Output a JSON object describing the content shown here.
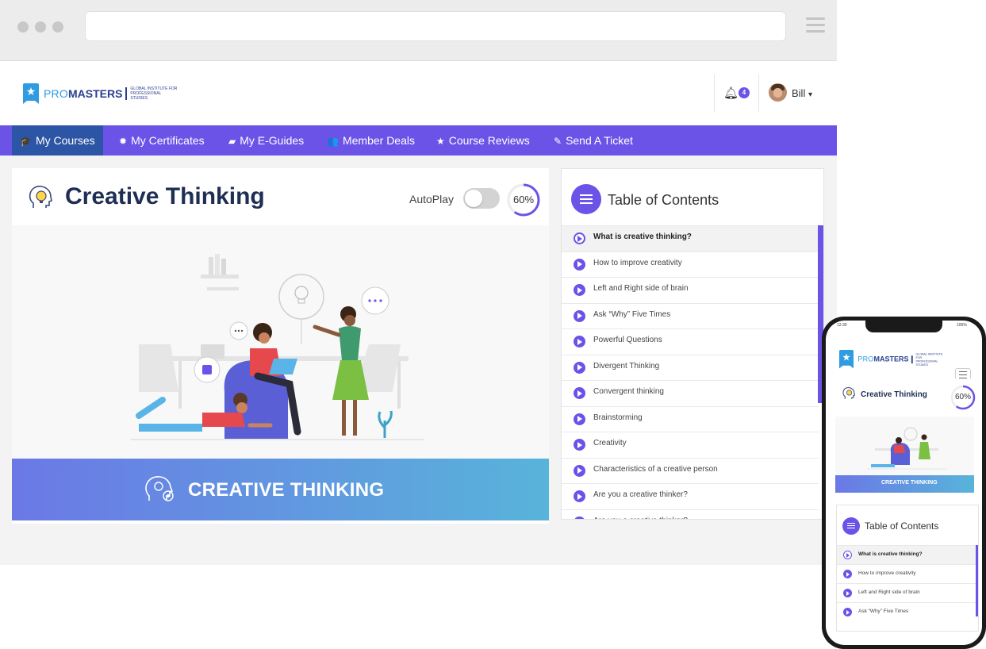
{
  "logo": {
    "pro": "PRO",
    "masters": "MASTERS",
    "tagline_1": "GLOBAL INSTITUTE FOR",
    "tagline_2": "PROFESSIONAL STUDIES"
  },
  "header": {
    "notification_count": "4",
    "user_name": "Bill",
    "user_caret": "▾"
  },
  "nav": [
    {
      "label": "My Courses",
      "icon": "graduation-cap-icon",
      "glyph": "🎓",
      "active": true
    },
    {
      "label": "My Certificates",
      "icon": "certificate-icon",
      "glyph": "✹",
      "active": false
    },
    {
      "label": "My E-Guides",
      "icon": "book-icon",
      "glyph": "▰",
      "active": false
    },
    {
      "label": "Member Deals",
      "icon": "users-icon",
      "glyph": "👥",
      "active": false
    },
    {
      "label": "Course Reviews",
      "icon": "star-icon",
      "glyph": "★",
      "active": false
    },
    {
      "label": "Send A Ticket",
      "icon": "edit-icon",
      "glyph": "✎",
      "active": false
    }
  ],
  "course": {
    "title": "Creative Thinking",
    "autoplay_label": "AutoPlay",
    "autoplay_on": false,
    "progress": 0.6,
    "progress_label": "60%",
    "banner_text": "CREATIVE THINKING"
  },
  "toc": {
    "title": "Table of Contents",
    "items": [
      "What is creative thinking?",
      "How to improve creativity",
      "Left and Right side of brain",
      "Ask “Why” Five Times",
      "Powerful Questions",
      "Divergent Thinking",
      "Convergent thinking",
      "Brainstorming",
      "Creativity",
      "Characteristics of a creative person",
      "Are you a creative thinker?",
      "Are you a creative thinker?"
    ]
  },
  "phone": {
    "time": "12:30",
    "battery": "100%",
    "course_title": "Creative Thinking",
    "progress_label": "60%",
    "banner_text": "CREATIVE THINKING",
    "toc_title": "Table of Contents",
    "toc_items": [
      "What is creative thinking?",
      "How to improve creativity",
      "Left and Right side of brain",
      "Ask “Why” Five Times"
    ]
  },
  "colors": {
    "accent": "#6b53e8",
    "nav_active": "#2d55a5",
    "title": "#1f2e53",
    "banner_start": "#6b78e6",
    "banner_end": "#58b4da"
  }
}
